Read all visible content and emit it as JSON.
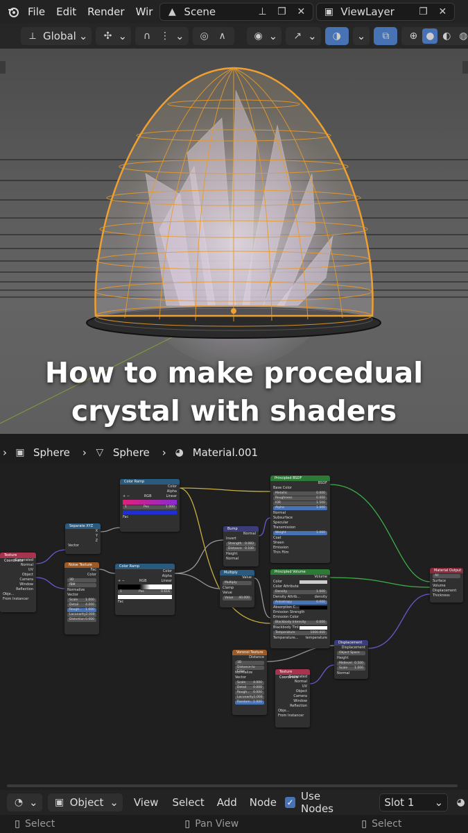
{
  "topbar": {
    "menus": [
      "File",
      "Edit",
      "Render",
      "Wir"
    ],
    "scene": "Scene",
    "view_layer": "ViewLayer"
  },
  "header": {
    "orientation": "Global"
  },
  "overlay_title": {
    "line1": "How to make procedual",
    "line2": "crystal with shaders"
  },
  "breadcrumb": {
    "object": "Sphere",
    "mesh": "Sphere",
    "material": "Material.001"
  },
  "nodes": {
    "tex_coord_1": {
      "title": "Texture Coordinate",
      "outputs": [
        "Generated",
        "Normal",
        "UV",
        "Object",
        "Camera",
        "Window",
        "Reflection"
      ],
      "object_label": "Obje...",
      "from_instancer": "From Instancer"
    },
    "separate_xyz": {
      "title": "Separate XYZ",
      "outputs": [
        "X",
        "Y",
        "Z"
      ],
      "input": "Vector"
    },
    "noise": {
      "title": "Noise Texture",
      "outputs": [
        "Fac",
        "Color"
      ],
      "dim": "3D",
      "type": "fBM",
      "normalize": "Normalize",
      "input": "Vector",
      "fields": [
        [
          "Scale",
          "1.000"
        ],
        [
          "Detail",
          "4.000"
        ],
        [
          "Rough...",
          "1.000"
        ],
        [
          "Lacunarity",
          "2.000"
        ],
        [
          "Distortion",
          "0.000"
        ]
      ]
    },
    "ramp_top": {
      "title": "Color Ramp",
      "outputs": [
        "Color",
        "Alpha"
      ],
      "mode": "RGB",
      "interp": "Linear",
      "index": "1",
      "pos_label": "Pos",
      "pos": "1.000",
      "input": "Fac"
    },
    "ramp_mid": {
      "title": "Color Ramp",
      "outputs": [
        "Color",
        "Alpha"
      ],
      "mode": "RGB",
      "interp": "Linear",
      "index": "1",
      "pos_label": "Pos",
      "pos": "0.616",
      "input": "Fac"
    },
    "bump": {
      "title": "Bump",
      "output": "Normal",
      "invert": "Invert",
      "fields": [
        [
          "Strength",
          "0.083"
        ],
        [
          "Distance",
          "0.100"
        ]
      ],
      "inputs": [
        "Height",
        "Normal"
      ]
    },
    "multiply": {
      "title": "Multiply",
      "output": "Value",
      "op": "Multiply",
      "clamp": "Clamp",
      "input": "Value",
      "field": [
        "Value",
        "40.000"
      ]
    },
    "bsdf": {
      "title": "Principled BSDF",
      "output": "BSDF",
      "base_color": "Base Color",
      "fields": [
        [
          "Metallic",
          "0.000"
        ],
        [
          "Roughness",
          "0.000"
        ],
        [
          "IOR",
          "1.500"
        ],
        [
          "Alpha",
          "1.000"
        ]
      ],
      "sections": [
        "Normal",
        "Subsurface",
        "Specular",
        "Transmission"
      ],
      "weight": [
        "Weight",
        "1.000"
      ],
      "more": [
        "Coat",
        "Sheen",
        "Emission",
        "Thin Film"
      ]
    },
    "volume": {
      "title": "Principled Volume",
      "output": "Volume",
      "rows": [
        [
          "Color",
          ""
        ],
        [
          "Color Attribute",
          ""
        ],
        [
          "Density",
          "1.000"
        ],
        [
          "Density Attrib...",
          "density"
        ],
        [
          "Anisotropy",
          "0.000"
        ],
        [
          "Absorption C...",
          ""
        ]
      ],
      "rows2": [
        "Emission Strength",
        "Emission Color"
      ],
      "rows3": [
        [
          "Blackbody Intensity",
          "0.000"
        ],
        [
          "Blackbody Tint",
          ""
        ],
        [
          "Temperature",
          "1000.000"
        ],
        [
          "Temperature...",
          "temperature"
        ]
      ]
    },
    "voronoi": {
      "title": "Voronoi Texture",
      "output": "Distance",
      "dim": "3D",
      "feature": "Distance to Edge",
      "normalize": "Normalize",
      "input": "Vector",
      "fields": [
        [
          "Scale",
          "4.000"
        ],
        [
          "Detail",
          "0.000"
        ],
        [
          "Rough...",
          "0.000"
        ],
        [
          "Lacunarity",
          "1.000"
        ],
        [
          "Random...",
          "1.000"
        ]
      ]
    },
    "tex_coord_2": {
      "title": "Texture Coordinate",
      "outputs": [
        "Generated",
        "Normal",
        "UV",
        "Object",
        "Camera",
        "Window",
        "Reflection"
      ],
      "object_label": "Obje...",
      "from_instancer": "From Instancer"
    },
    "displacement": {
      "title": "Displacement",
      "output": "Displacement",
      "space": "Object Space",
      "inputs": [
        "Height"
      ],
      "fields": [
        [
          "Midlevel",
          "0.500"
        ],
        [
          "Scale",
          "1.000"
        ]
      ],
      "normal": "Normal"
    },
    "output": {
      "title": "Material Output",
      "target": "All",
      "inputs": [
        "Surface",
        "Volume",
        "Displacement",
        "Thickness"
      ]
    }
  },
  "bottombar": {
    "mode": "Object",
    "menus": [
      "View",
      "Select",
      "Add",
      "Node"
    ],
    "use_nodes": "Use Nodes",
    "slot": "Slot 1"
  },
  "statusbar": {
    "left": "Select",
    "mid": "Pan View",
    "right": "Select"
  },
  "colors": {
    "accent": "#4772b3",
    "selection_orange": "#f0a030",
    "header_input": "#a8334f",
    "header_texture": "#9e5a24",
    "header_converter": "#2a5a7d",
    "header_shader": "#2d7a36",
    "header_vector": "#3a3d7a",
    "header_output": "#8a2a3a"
  }
}
